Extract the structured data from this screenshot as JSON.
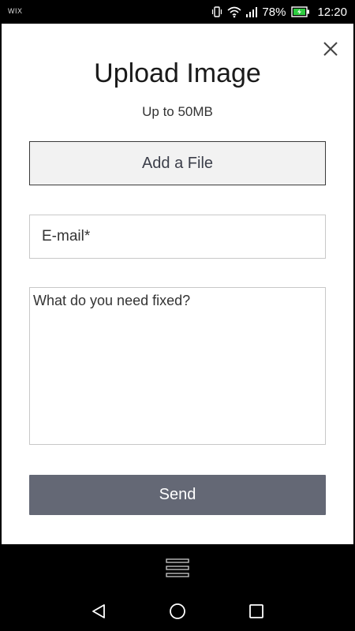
{
  "status_bar": {
    "app_label": "WIX",
    "battery": "78%",
    "time": "12:20",
    "icons": [
      "vibrate-icon",
      "wifi-icon",
      "signal-icon",
      "battery-charging-icon"
    ],
    "battery_color": "#2ecc40"
  },
  "dialog": {
    "title": "Upload Image",
    "subtitle": "Up to 50MB",
    "add_file_label": "Add a File",
    "email_placeholder": "E-mail*",
    "message_placeholder": "What do you need fixed?",
    "send_label": "Send",
    "close_icon": "close-icon"
  },
  "colors": {
    "send_button_bg": "#646875",
    "add_file_bg": "#f2f2f2",
    "text_dark": "#1a1a1a"
  },
  "bottom": {
    "menu_icon": "hamburger-menu-icon",
    "nav": [
      "back-icon",
      "home-icon",
      "recents-icon"
    ]
  }
}
